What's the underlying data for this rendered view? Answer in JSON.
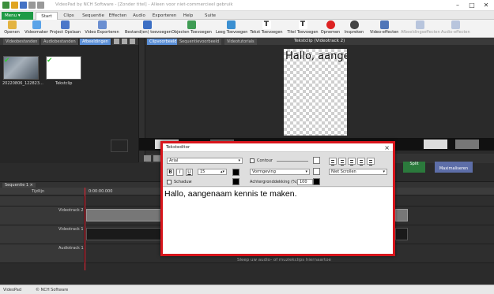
{
  "app": {
    "title": "VideoPad by NCH Software - [Zonder titel] - Alleen voor niet-commercieel gebruik"
  },
  "menu": {
    "label": "Menu"
  },
  "tabs": [
    "Start",
    "Clips",
    "Sequentie",
    "Effecten",
    "Audio",
    "Exporteren",
    "Help",
    "Suite"
  ],
  "toolbar": {
    "items": [
      {
        "label": "Openen"
      },
      {
        "label": "Videomaker"
      },
      {
        "label": "Project Opslaan"
      },
      {
        "label": "Video Exporteren"
      },
      {
        "label": "Bestand(en) toevoegen"
      },
      {
        "label": "Objecten Toevoegen"
      },
      {
        "label": "Leeg Toevoegen"
      },
      {
        "label": "Tekst Toevoegen"
      },
      {
        "label": "Titel Toevoegen"
      },
      {
        "label": "Opnemen"
      },
      {
        "label": "Inspreken"
      },
      {
        "label": "Video-effecten"
      },
      {
        "label": "Afbeeldingseffecten"
      },
      {
        "label": "Audio-effecten"
      }
    ]
  },
  "left_tabs": [
    "Videobestanden",
    "Audiobestanden",
    "Afbeeldingen"
  ],
  "bin": {
    "items": [
      {
        "label": "20220806_122823..."
      },
      {
        "label": "Tekstclip"
      }
    ]
  },
  "preview_tabs": [
    "Clipvoorbeeld",
    "Sequentievoorbeeld",
    "Videotutorials"
  ],
  "preview": {
    "title": "Tekstclip (Videotrack 2)",
    "canvas_text": "Hallo, aangen"
  },
  "preview_controls": {
    "split_label": "Split",
    "fullscreen_label": "Maximaliseren"
  },
  "sequence": {
    "tab": "Sequentie 1",
    "time_label": "Tijdlijn",
    "timecode": "0:00:00.000"
  },
  "tracks": [
    {
      "name": "Videotrack 2"
    },
    {
      "name": "Videotrack 1"
    },
    {
      "name": "Audiotrack 1"
    }
  ],
  "audio_hint": "Sleep uw audio- of muziekclips hiernaartoe",
  "status": {
    "left": "VideoPad",
    "center": "© NCH Software"
  },
  "dialog": {
    "title": "Teksteditor",
    "close": "×",
    "font": "Arial",
    "size": "15",
    "contour_label": "Contour",
    "shadow_label": "Schaduw",
    "style_value": "Vormgeving",
    "bg_label": "Achtergronddekking (%):",
    "bg_value": "100",
    "scroll_value": "Niet Scrollen",
    "bold": "B",
    "italic": "I",
    "underline": "U",
    "text": "Hallo, aangenaam kennis te maken."
  },
  "colors": {
    "accent": "#5b8fd6",
    "menu_green": "#1f9a45",
    "dialog_border": "#d8151c",
    "playhead": "#e22233"
  }
}
